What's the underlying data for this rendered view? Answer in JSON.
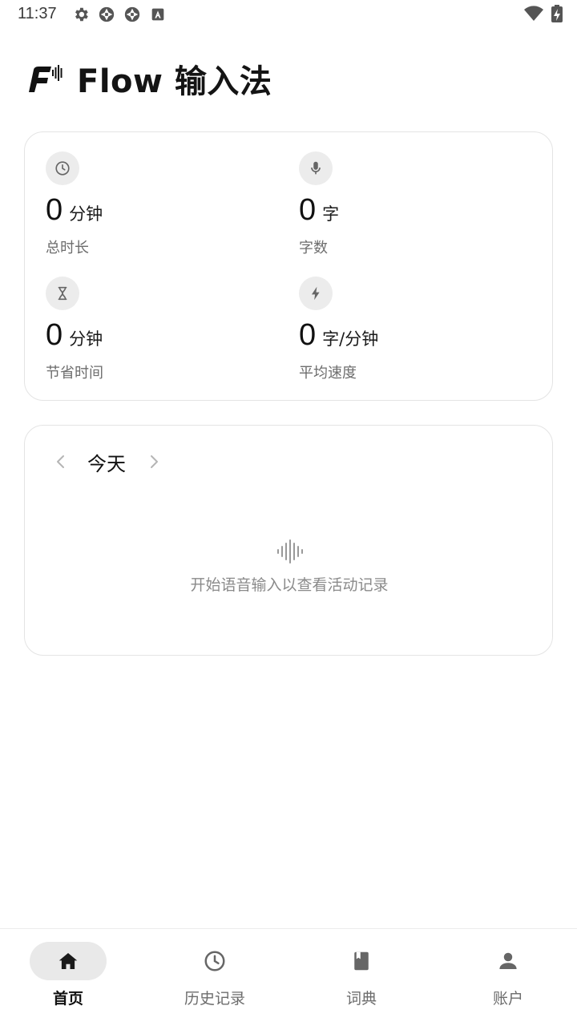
{
  "status_bar": {
    "time": "11:37",
    "left_icons": [
      "gear-icon",
      "aperture-icon",
      "aperture-icon",
      "keyboard-a-icon"
    ],
    "right_icons": [
      "wifi-icon",
      "battery-charging-icon"
    ]
  },
  "header": {
    "title": "Flow 输入法",
    "logo_icon": "flow-logo-icon"
  },
  "stats": [
    {
      "icon": "clock-icon",
      "value": "0",
      "unit": "分钟",
      "label": "总时长"
    },
    {
      "icon": "microphone-icon",
      "value": "0",
      "unit": "字",
      "label": "字数"
    },
    {
      "icon": "hourglass-icon",
      "value": "0",
      "unit": "分钟",
      "label": "节省时间"
    },
    {
      "icon": "lightning-icon",
      "value": "0",
      "unit": "字/分钟",
      "label": "平均速度"
    }
  ],
  "activity": {
    "date_label": "今天",
    "empty_icon": "waveform-icon",
    "empty_text": "开始语音输入以查看活动记录"
  },
  "bottom_nav": [
    {
      "label": "首页",
      "icon": "home-icon",
      "active": true
    },
    {
      "label": "历史记录",
      "icon": "clock-icon",
      "active": false
    },
    {
      "label": "词典",
      "icon": "book-icon",
      "active": false
    },
    {
      "label": "账户",
      "icon": "person-icon",
      "active": false
    }
  ],
  "colors": {
    "text_primary": "#111111",
    "text_secondary": "#6d6d6d",
    "card_border": "#e4e4e4",
    "icon_circle_bg": "#ececec",
    "active_pill_bg": "#e9e9e9"
  }
}
